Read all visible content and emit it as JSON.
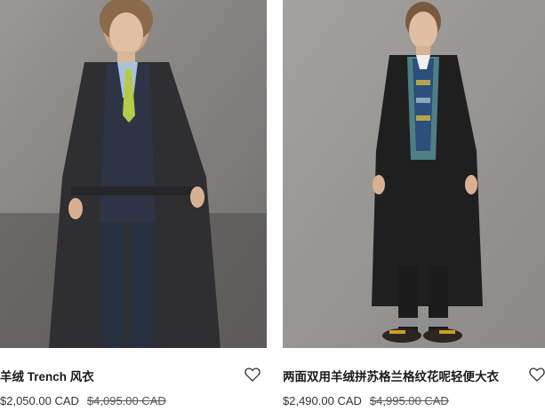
{
  "products": [
    {
      "name": "羊绒 Trench 风衣",
      "price": "$2,050.00 CAD",
      "original_price": "$4,095.00 CAD"
    },
    {
      "name": "两面双用羊绒拼苏格兰格纹花呢轻便大衣",
      "price": "$2,490.00 CAD",
      "original_price": "$4,995.00 CAD"
    }
  ],
  "icons": {
    "favorite": "heart-outline-icon"
  },
  "colors": {
    "backdrop": "#8a8a8a",
    "text": "#1a1a1a"
  }
}
